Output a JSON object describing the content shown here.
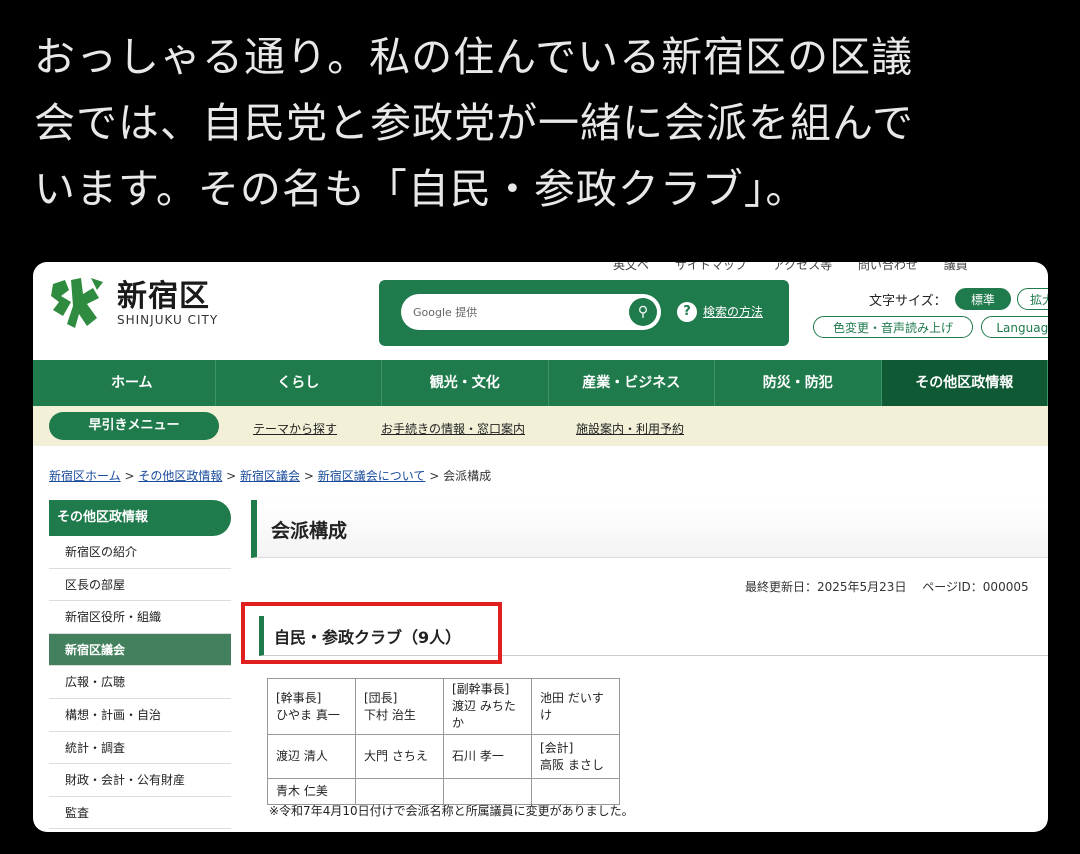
{
  "post": {
    "lines": [
      "おっしゃる通り。私の住んでいる新宿区の区議",
      "会では、自民党と参政党が一緒に会派を組んで",
      "います。その名も「自民・参政クラブ」。"
    ]
  },
  "site": {
    "util_links": [
      "英文ペ",
      "サイトマップ",
      "アクセス等",
      "問い合わせ",
      "議員"
    ],
    "logo_jp": "新宿区",
    "logo_en": "SHINJUKU CITY",
    "search_placeholder": "Google 提供",
    "search_help": "検索の方法",
    "fontsize_label": "文字サイズ：",
    "fontsize_standard": "標準",
    "fontsize_large": "拡大",
    "color_change": "色変更・音声読み上げ",
    "language": "Language",
    "gnav": [
      "ホーム",
      "くらし",
      "観光・文化",
      "産業・ビジネス",
      "防災・防犯",
      "その他区政情報"
    ],
    "quick_menu": "早引きメニュー",
    "subnav": [
      "テーマから探す",
      "お手続きの情報・窓口案内",
      "施設案内・利用予約"
    ],
    "breadcrumb": {
      "items": [
        "新宿区ホーム",
        "その他区政情報",
        "新宿区議会",
        "新宿区議会について"
      ],
      "sep": " > ",
      "current": "会派構成"
    },
    "side": {
      "head": "その他区政情報",
      "items": [
        "新宿区の紹介",
        "区長の部屋",
        "新宿区役所・組織",
        "新宿区議会",
        "広報・広聴",
        "構想・計画・自治",
        "統計・調査",
        "財政・会計・公有財産",
        "監査"
      ]
    },
    "page_title": "会派構成",
    "updated": "最終更新日：2025年5月23日　 ページID：000005",
    "section_title": "自民・参政クラブ（9人）",
    "table": {
      "r1": [
        "[幹事長]",
        "ひやま 真一",
        "[団長]",
        "下村 治生",
        "[副幹事長]",
        "渡辺 みちたか",
        "池田 だいすけ"
      ],
      "r2": [
        "渡辺 清人",
        "大門 さちえ",
        "石川 孝一",
        "[会計]",
        "高阪 まさし"
      ],
      "r3": [
        "青木 仁美"
      ]
    },
    "note": "※令和7年4月10日付けで会派名称と所属議員に変更がありました。"
  }
}
